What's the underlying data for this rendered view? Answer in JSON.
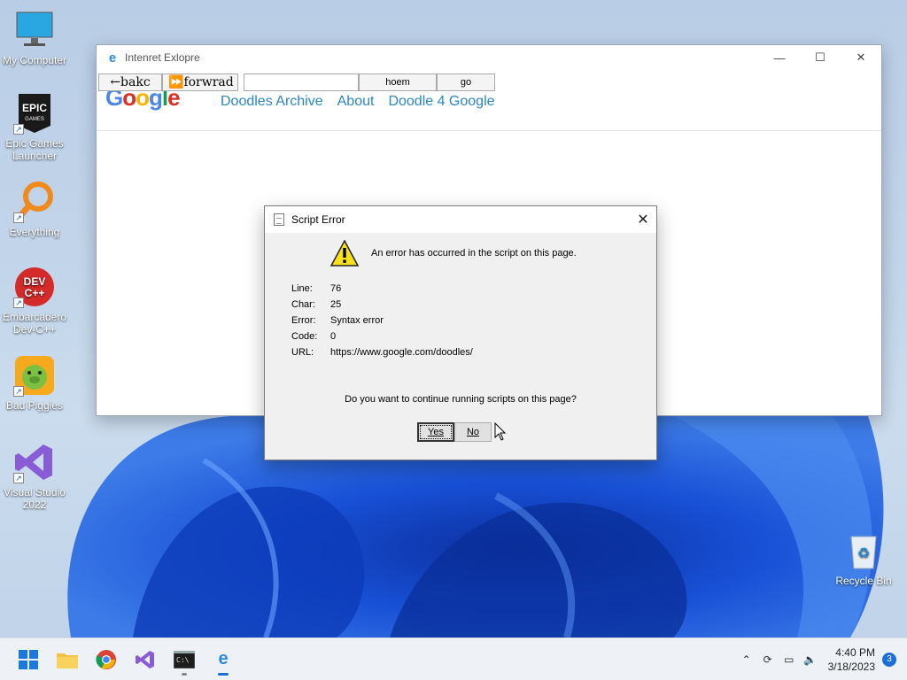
{
  "desktop": {
    "icons": [
      {
        "label": "My Computer"
      },
      {
        "label": "Epic Games Launcher",
        "badge": "EPIC GAMES"
      },
      {
        "label": "Everything"
      },
      {
        "label": "Embarcadero Dev-C++",
        "badge": "DEV C++"
      },
      {
        "label": "Bad Piggies"
      },
      {
        "label": "Visual Studio 2022"
      },
      {
        "label": "Recycle Bin"
      }
    ]
  },
  "browser": {
    "title": "Intenret Exlopre",
    "back_label": "←bakc",
    "forward_label": "forwrad",
    "address_value": "",
    "home_label": "hoem",
    "go_label": "go",
    "logo_text": "Google",
    "nav_links": [
      "Doodles Archive",
      "About",
      "Doodle 4 Google"
    ]
  },
  "dialog": {
    "title": "Script Error",
    "message": "An error has occurred in the script on this page.",
    "fields": [
      {
        "key": "Line:",
        "value": "76"
      },
      {
        "key": "Char:",
        "value": "25"
      },
      {
        "key": "Error:",
        "value": "Syntax error"
      },
      {
        "key": "Code:",
        "value": "0"
      },
      {
        "key": "URL:",
        "value": "https://www.google.com/doodles/"
      }
    ],
    "question": "Do you want to continue running scripts on this page?",
    "yes_label": "Yes",
    "no_label": "No"
  },
  "taskbar": {
    "apps": [
      "start-icon",
      "file-explorer-icon",
      "chrome-icon",
      "visual-studio-icon",
      "terminal-icon",
      "internet-explorer-icon"
    ],
    "time": "4:40 PM",
    "date": "3/18/2023",
    "notification_count": "3"
  },
  "colors": {
    "accent": "#1b6fd6",
    "link": "#2b86c6",
    "wallpaper_blue": "#1a4fd0"
  }
}
